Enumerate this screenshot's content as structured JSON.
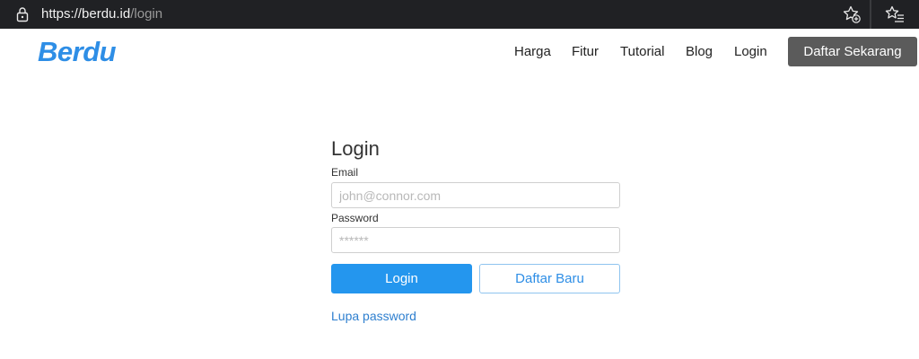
{
  "browser": {
    "url_host": "https://berdu.id",
    "url_path": "/login",
    "icons": {
      "lock": "lock-icon",
      "add_favorite": "star-add-icon",
      "favorites": "favorites-list-icon"
    }
  },
  "site": {
    "brand": "Berdu",
    "brand_color": "#2e8ee6",
    "nav": {
      "harga": "Harga",
      "fitur": "Fitur",
      "tutorial": "Tutorial",
      "blog": "Blog",
      "login": "Login"
    },
    "cta_label": "Daftar Sekarang",
    "cta_color": "#5b5b5b"
  },
  "login_form": {
    "title": "Login",
    "email_label": "Email",
    "email_placeholder": "john@connor.com",
    "email_value": "",
    "password_label": "Password",
    "password_placeholder": "******",
    "password_value": "",
    "login_button": "Login",
    "login_button_color": "#2496ee",
    "register_button": "Daftar Baru",
    "forgot_link": "Lupa password"
  }
}
